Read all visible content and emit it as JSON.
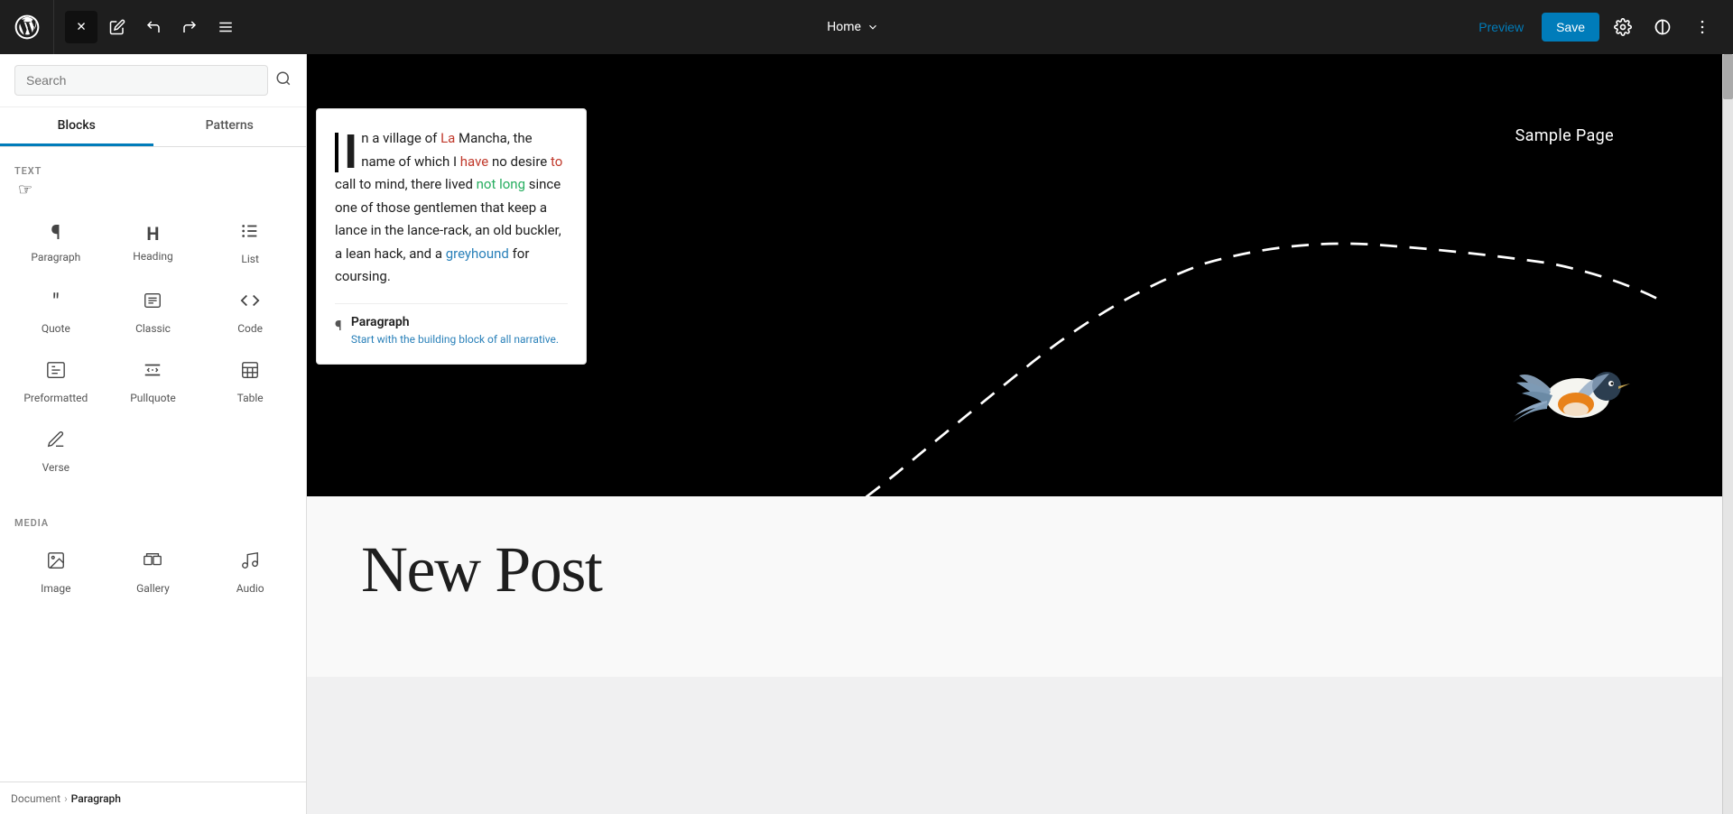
{
  "toolbar": {
    "close_label": "✕",
    "edit_icon": "✏",
    "undo_icon": "↩",
    "redo_icon": "↪",
    "menu_icon": "≡",
    "page_name": "Home",
    "chevron_down": "∨",
    "preview_label": "Preview",
    "save_label": "Save",
    "settings_icon": "⚙",
    "contrast_icon": "◑",
    "more_icon": "⋮"
  },
  "sidebar": {
    "search_placeholder": "Search",
    "search_icon": "🔍",
    "tabs": [
      {
        "label": "Blocks",
        "active": true
      },
      {
        "label": "Patterns",
        "active": false
      }
    ],
    "text_section_label": "TEXT",
    "media_section_label": "MEDIA",
    "blocks": [
      {
        "icon": "¶",
        "label": "Paragraph"
      },
      {
        "icon": "⌃",
        "label": "Heading"
      },
      {
        "icon": "≡",
        "label": "List"
      },
      {
        "icon": "❝",
        "label": "Quote"
      },
      {
        "icon": "⌨",
        "label": "Classic"
      },
      {
        "icon": "<>",
        "label": "Code"
      },
      {
        "icon": "▤",
        "label": "Preformatted"
      },
      {
        "icon": "≈",
        "label": "Pullquote"
      },
      {
        "icon": "⊞",
        "label": "Table"
      },
      {
        "icon": "✍",
        "label": "Verse"
      }
    ],
    "media_blocks": [
      {
        "icon": "🖼",
        "label": "Image"
      },
      {
        "icon": "▬",
        "label": "Gallery"
      },
      {
        "icon": "♪",
        "label": "Audio"
      }
    ]
  },
  "breadcrumb": {
    "items": [
      {
        "label": "Document",
        "active": false
      },
      {
        "label": "Paragraph",
        "active": true
      }
    ]
  },
  "canvas": {
    "sample_page_label": "Sample Page",
    "hero_text": "In a village of La Mancha, the name of which I have no desire to call to mind, there lived not long since one of those gentlemen that keep a lance in the lance-rack, an old buckler, a lean hack, and a greyhound for coursing.",
    "popup_paragraph_title": "Paragraph",
    "popup_paragraph_desc": "Start with the building block of all narrative.",
    "new_post_title": "New Post"
  }
}
